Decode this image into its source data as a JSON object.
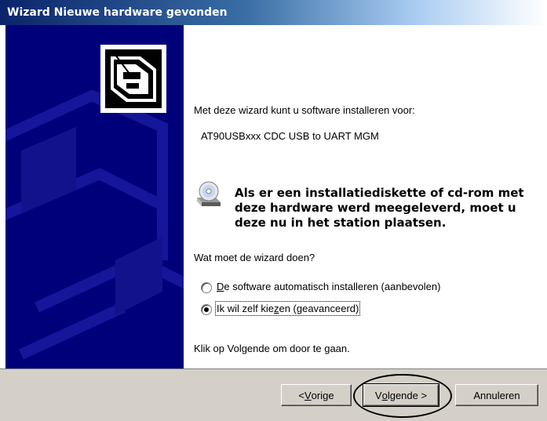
{
  "window": {
    "title": "Wizard Nieuwe hardware gevonden"
  },
  "content": {
    "intro": "Met deze wizard kunt u software installeren voor:",
    "device_name": "AT90USBxxx CDC USB to UART MGM",
    "cd_hint_line1": "Als er een installatiediskette of cd-rom met",
    "cd_hint_line2": "deze hardware werd meegeleverd, moet u",
    "cd_hint_line3": "deze nu in het station plaatsen.",
    "question": "Wat moet de wizard doen?",
    "options": [
      {
        "accel": "D",
        "rest": "e software automatisch installeren (aanbevolen)",
        "selected": false
      },
      {
        "pre": "Ik wil zelf kie",
        "accel": "z",
        "rest": "en (geavanceerd)",
        "selected": true
      }
    ],
    "continue_hint": "Klik op Volgende om door te gaan."
  },
  "buttons": {
    "back": {
      "prefix": "< ",
      "accel": "V",
      "rest": "orige"
    },
    "next": {
      "pre": "V",
      "accel": "o",
      "rest": "lgende >"
    },
    "cancel": "Annuleren"
  },
  "icons": {
    "side_graphic": "hardware-box-icon",
    "cd": "cd-drive-icon"
  },
  "colors": {
    "side_panel": "#00007b",
    "title_start": "#0a246a",
    "dialog": "#d4d0c8"
  }
}
